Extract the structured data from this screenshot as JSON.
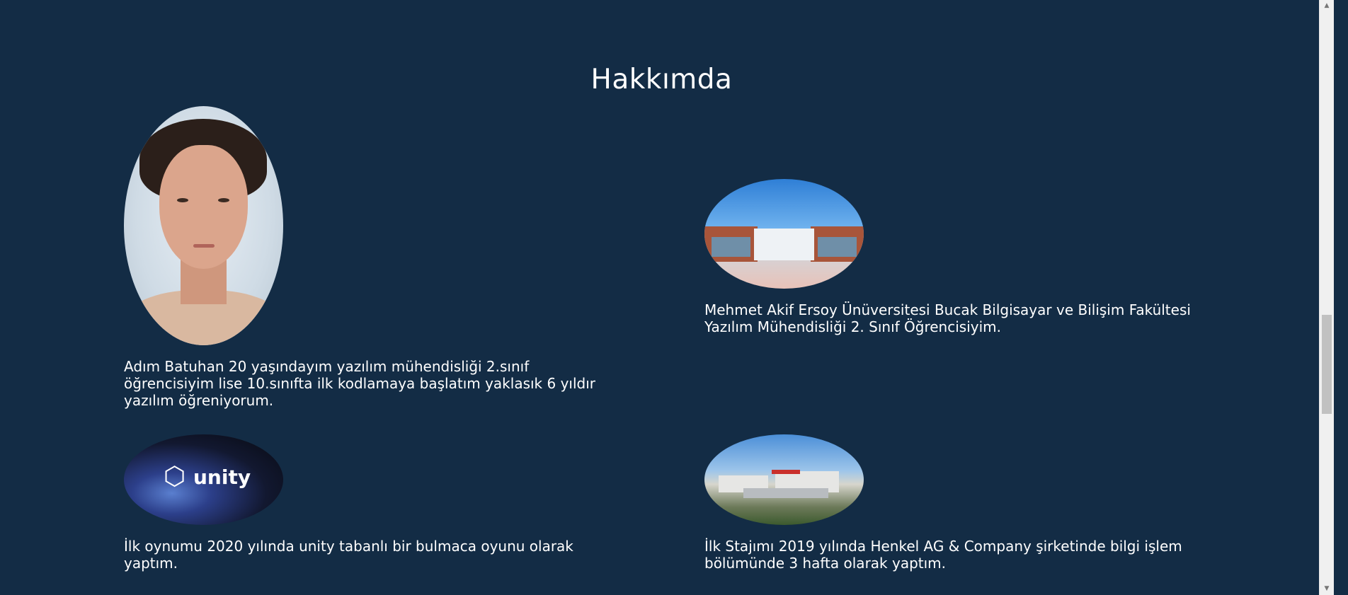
{
  "section": {
    "title": "Hakkımda"
  },
  "cards": [
    {
      "image_name": "portrait-photo",
      "text": "Adım Batuhan 20 yaşındayım yazılım mühendisliği 2.sınıf öğrencisiyim lise 10.sınıfta ilk kodlamaya başlatım yaklasık 6 yıldır yazılım öğreniyorum."
    },
    {
      "image_name": "university-campus-photo",
      "text": "Mehmet Akif Ersoy Ünüversitesi Bucak Bilgisayar ve Bilişim Fakültesi Yazılım Mühendisliği 2. Sınıf Öğrencisiyim."
    },
    {
      "image_name": "unity-logo-image",
      "logo_text": "unity",
      "text": "İlk oynumu 2020 yılında unity tabanlı bir bulmaca oyunu olarak yaptım."
    },
    {
      "image_name": "henkel-factory-photo",
      "text": "İlk Stajımı 2019 yılında Henkel AG & Company şirketinde bilgi işlem bölümünde 3 hafta olarak yaptım."
    }
  ],
  "scrollbar": {
    "up_icon": "chevron-up-icon",
    "down_icon": "chevron-down-icon"
  }
}
